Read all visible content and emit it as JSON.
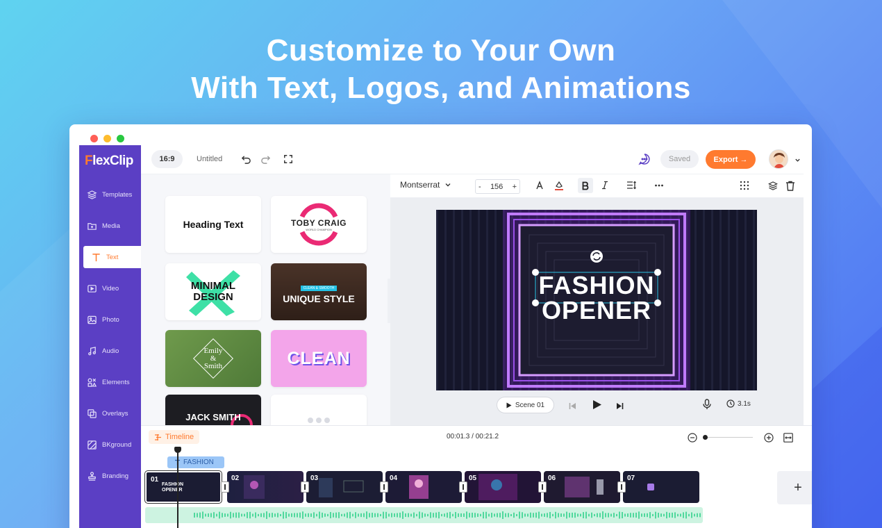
{
  "headline": {
    "line1": "Customize to Your Own",
    "line2": "With Text, Logos, and Animations"
  },
  "colors": {
    "accent": "#ff7a2f",
    "sidebar": "#5b3fc4",
    "dot_red": "#ff5f57",
    "dot_yellow": "#febc2e",
    "dot_green": "#28c840"
  },
  "app": {
    "logo": "FlexClip",
    "logo_first": "F",
    "logo_rest": "lexClip"
  },
  "sidebar": {
    "items": [
      {
        "label": "Templates",
        "icon": "layers-icon"
      },
      {
        "label": "Media",
        "icon": "folder-plus-icon"
      },
      {
        "label": "Text",
        "icon": "text-icon",
        "active": true
      },
      {
        "label": "Video",
        "icon": "video-icon"
      },
      {
        "label": "Photo",
        "icon": "image-icon"
      },
      {
        "label": "Audio",
        "icon": "music-icon"
      },
      {
        "label": "Elements",
        "icon": "shapes-icon"
      },
      {
        "label": "Overlays",
        "icon": "overlay-icon"
      },
      {
        "label": "BKground",
        "icon": "background-icon"
      },
      {
        "label": "Branding",
        "icon": "stamp-icon"
      }
    ]
  },
  "topbar": {
    "ratio": "16:9",
    "title": "Untitled",
    "saved": "Saved",
    "export": "Export →"
  },
  "text_panel": {
    "cards": [
      {
        "label": "Heading Text"
      },
      {
        "line1": "TOBY CRAIG",
        "line2": "WORLD CHAMPION"
      },
      {
        "line1": "MINIMAL",
        "line2": "DESIGN"
      },
      {
        "tag": "CLEAN & SMOOTH",
        "label": "UNIQUE STYLE"
      },
      {
        "line1": "Emily",
        "line2": "&",
        "line3": "Smith"
      },
      {
        "label": "CLEAN"
      },
      {
        "label": "JACK SMITH"
      }
    ]
  },
  "format_bar": {
    "font": "Montserrat",
    "size": "156",
    "minus": "-",
    "plus": "+"
  },
  "canvas": {
    "line1": "FASHION",
    "line2": "OPENER"
  },
  "playbar": {
    "scene": "Scene 01",
    "duration": "3.1s"
  },
  "timeline": {
    "tag": "Timeline",
    "timecode": "00:01.3 / 00:21.2",
    "text_track": "FASHION",
    "scenes": [
      {
        "num": "01",
        "title": "FASHION\nOPENER"
      },
      {
        "num": "02"
      },
      {
        "num": "03"
      },
      {
        "num": "04"
      },
      {
        "num": "05"
      },
      {
        "num": "06"
      },
      {
        "num": "07"
      }
    ],
    "add": "+",
    "zoom": 0.0
  }
}
